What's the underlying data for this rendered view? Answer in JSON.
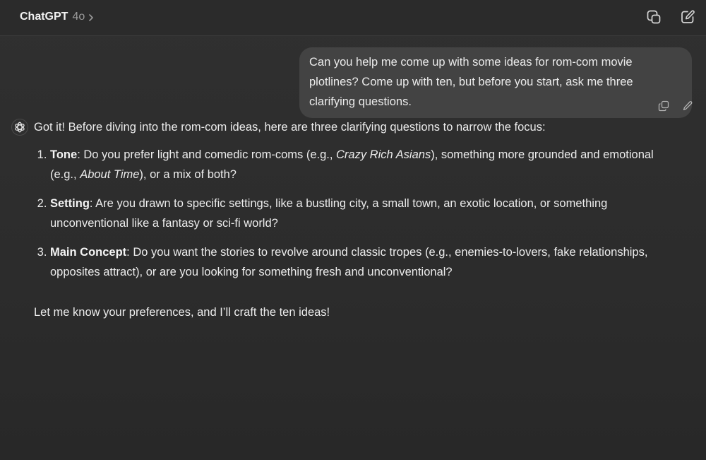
{
  "header": {
    "model_name": "ChatGPT",
    "model_version": "4o",
    "icons": [
      "chevron-right-icon",
      "temporary-chat-icon",
      "new-chat-icon"
    ]
  },
  "user_message": {
    "text": "Can you help me come up with some ideas for rom-com movie plotlines? Come up with ten, but before you start, ask me three clarifying questions.",
    "actions": [
      "copy-icon",
      "edit-icon"
    ]
  },
  "assistant_message": {
    "intro": "Got it! Before diving into the rom-com ideas, here are three clarifying questions to narrow the focus:",
    "questions": [
      {
        "title": "Tone",
        "text_before": ": Do you prefer light and comedic rom-coms (e.g., ",
        "italic1": "Crazy Rich Asians",
        "text_middle": "), something more grounded and emotional (e.g., ",
        "italic2": "About Time",
        "text_after": "), or a mix of both?"
      },
      {
        "title": "Setting",
        "text": ": Are you drawn to specific settings, like a bustling city, a small town, an exotic location, or something unconventional like a fantasy or sci-fi world?"
      },
      {
        "title": "Main Concept",
        "text": ": Do you want the stories to revolve around classic tropes (e.g., enemies-to-lovers, fake relationships, opposites attract), or are you looking for something fresh and unconventional?"
      }
    ],
    "closing": "Let me know your preferences, and I’ll craft the ten ideas!"
  },
  "colors": {
    "background": "#2f2f2f",
    "user_bubble": "#434343",
    "text": "#ececec",
    "muted": "#9a9a9a"
  }
}
